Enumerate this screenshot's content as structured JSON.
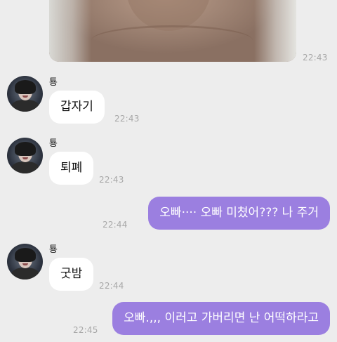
{
  "top_image": {
    "time": "22:43"
  },
  "messages": [
    {
      "sender": "툥",
      "text": "갑자기",
      "time": "22:43"
    },
    {
      "sender": "툥",
      "text": "퇴폐",
      "time": "22:43"
    },
    {
      "text": "오빠···· 오빠 미쳤어??? 나 주거",
      "time": "22:44"
    },
    {
      "sender": "툥",
      "text": "굿밤",
      "time": "22:44"
    },
    {
      "text": "오빠.,,, 이러고 가버리면 난 어떡하라고",
      "time": "22:45"
    }
  ],
  "colors": {
    "background": "#ededed",
    "incoming_bubble": "#ffffff",
    "outgoing_bubble": "#9b7fe0",
    "timestamp": "#a8a8a8"
  }
}
